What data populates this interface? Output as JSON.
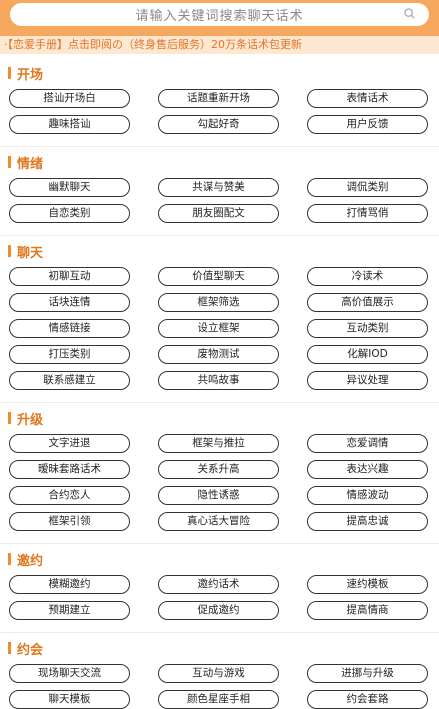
{
  "search": {
    "placeholder": "请输入关键词搜索聊天话术"
  },
  "banner": {
    "text": "·【恋爱手册】点击即阅の（终身售后服务）20万条话术包更新"
  },
  "sections": [
    {
      "title": "开场",
      "tags": [
        "搭讪开场白",
        "话题重新开场",
        "表情话术",
        "趣味搭讪",
        "勾起好奇",
        "用户反馈"
      ]
    },
    {
      "title": "情绪",
      "tags": [
        "幽默聊天",
        "共谋与赞美",
        "调侃类别",
        "自恋类别",
        "朋友圈配文",
        "打情骂俏"
      ]
    },
    {
      "title": "聊天",
      "tags": [
        "初聊互动",
        "价值型聊天",
        "冷读术",
        "话块连情",
        "框架筛选",
        "高价值展示",
        "情感链接",
        "设立框架",
        "互动类别",
        "打压类别",
        "废物测试",
        "化解IOD",
        "联系感建立",
        "共鸣故事",
        "异议处理"
      ]
    },
    {
      "title": "升级",
      "tags": [
        "文字进退",
        "框架与推拉",
        "恋爱调情",
        "暧昧套路话术",
        "关系升高",
        "表达兴趣",
        "合约恋人",
        "隐性诱惑",
        "情感波动",
        "框架引领",
        "真心话大冒险",
        "提高忠诚"
      ]
    },
    {
      "title": "邀约",
      "tags": [
        "模糊邀约",
        "邀约话术",
        "速约模板",
        "预期建立",
        "促成邀约",
        "提高情商"
      ]
    },
    {
      "title": "约会",
      "tags": [
        "现场聊天交流",
        "互动与游戏",
        "进挪与升级",
        "聊天模板",
        "颜色星座手相",
        "约会套路"
      ]
    }
  ]
}
